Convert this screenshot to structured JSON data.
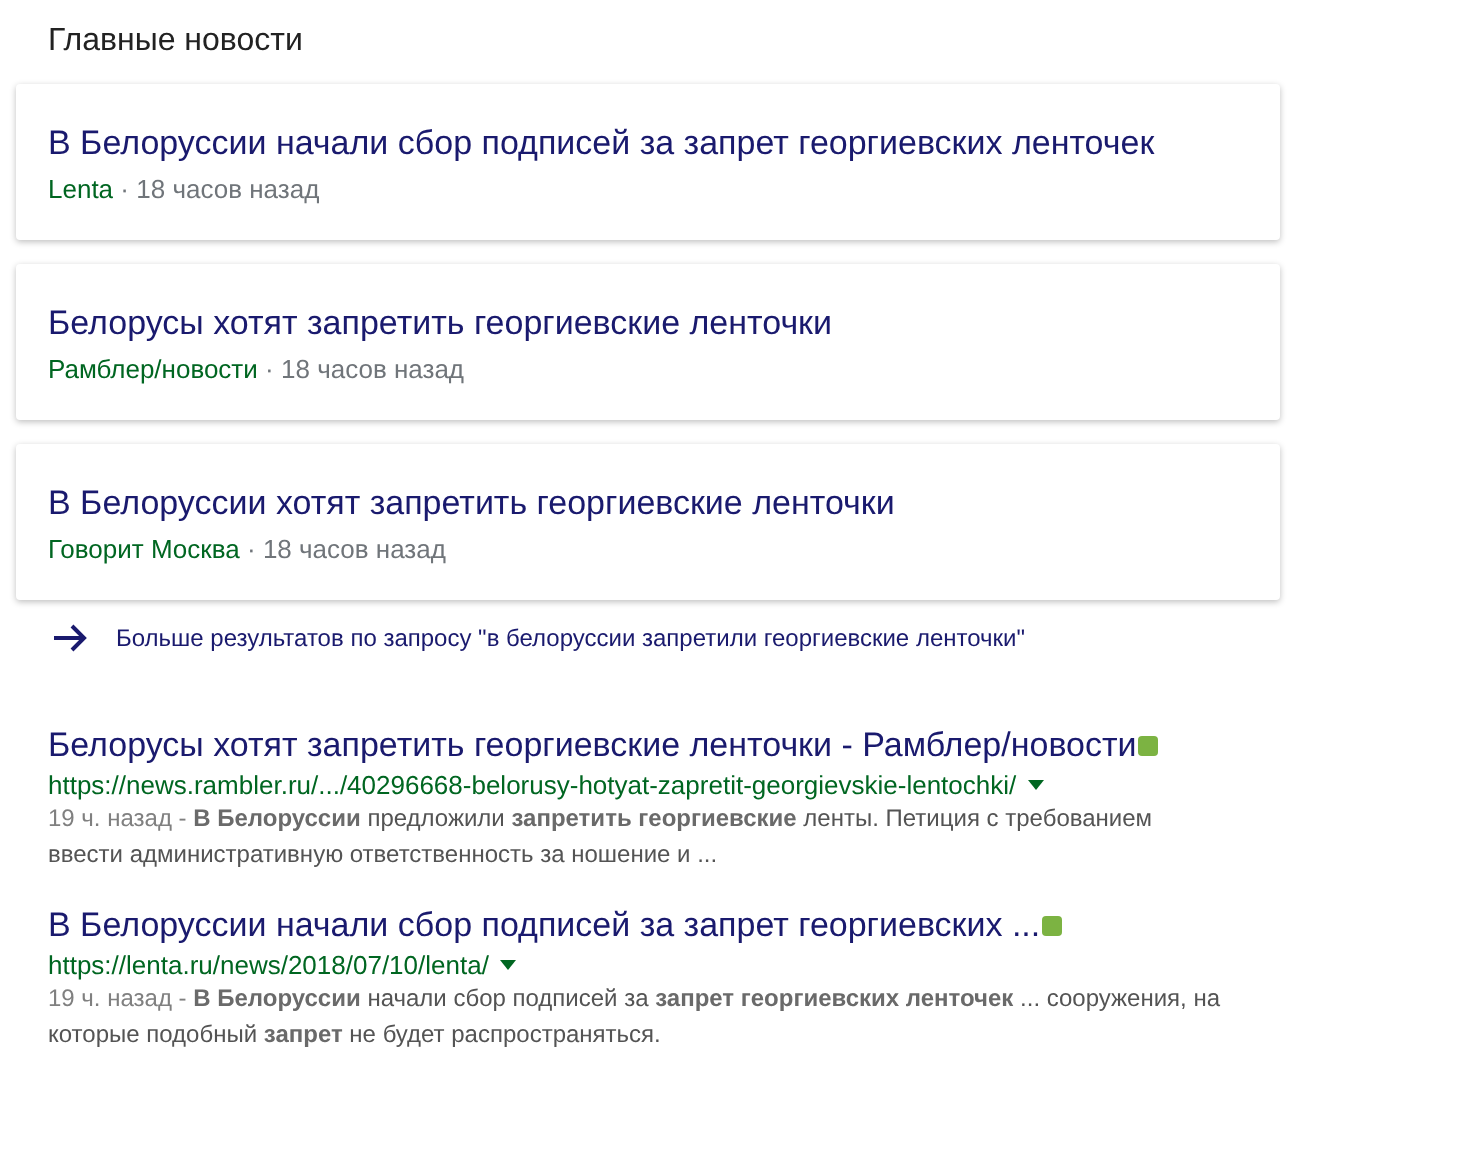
{
  "section_title": "Главные новости",
  "news": [
    {
      "title": "В Белоруссии начали сбор подписей за запрет георгиевских ленточек",
      "source": "Lenta",
      "separator": "·",
      "time": "18 часов назад"
    },
    {
      "title": "Белорусы хотят запретить георгиевские ленточки",
      "source": "Рамблер/новости",
      "separator": "·",
      "time": "18 часов назад"
    },
    {
      "title": "В Белоруссии хотят запретить георгиевские ленточки",
      "source": "Говорит Москва",
      "separator": "·",
      "time": "18 часов назад"
    }
  ],
  "more_link": "Больше результатов по запросу \"в белоруссии запретили георгиевские ленточки\"",
  "results": [
    {
      "title": "Белорусы хотят запретить георгиевские ленточки - Рамблер/новости",
      "url": "https://news.rambler.ru/.../40296668-belorusy-hotyat-zapretit-georgievskie-lentochki/",
      "date": "19 ч. назад - ",
      "snippet": "**В Белоруссии** предложили **запретить георгиевские** ленты. Петиция с требованием ввести административную ответственность за ношение и ..."
    },
    {
      "title": "В Белоруссии начали сбор подписей за запрет георгиевских ...",
      "url": "https://lenta.ru/news/2018/07/10/lenta/",
      "date": "19 ч. назад - ",
      "snippet": "**В Белоруссии** начали сбор подписей за **запрет георгиевских ленточек** ... сооружения, на которые подобный **запрет** не будет распространяться."
    }
  ]
}
